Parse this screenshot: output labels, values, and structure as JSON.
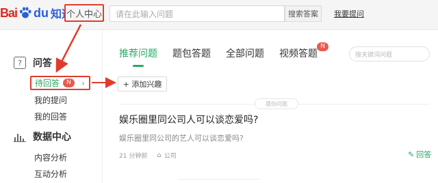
{
  "brand": {
    "bai": "Bai",
    "du": "du",
    "zhidao": "知道"
  },
  "header": {
    "user_center": "个人中心",
    "search_placeholder": "请在此输入问题",
    "search_button": "搜索答案",
    "ask_link": "我要提问"
  },
  "sidebar": {
    "qa_heading": "问答",
    "pending_label": "待回答",
    "pending_badge": "N",
    "my_questions": "我的提问",
    "my_answers": "我的回答",
    "data_heading": "数据中心",
    "content_analysis": "内容分析",
    "interaction_analysis": "互动分析"
  },
  "tabs": [
    {
      "label": "推荐问题"
    },
    {
      "label": "题包答题"
    },
    {
      "label": "全部问题"
    },
    {
      "label": "视频答题",
      "badge": "N"
    }
  ],
  "tab_search_placeholder": "搜关键词问题",
  "interest_button": "+ 添加兴趣",
  "recommend_tag": "猜你问题",
  "question": {
    "title": "娱乐圈里同公司人可以谈恋爱吗?",
    "description": "娱乐圈里同公司的艺人可以谈恋爱吗?",
    "time": "21 分钟前",
    "tag": "公司",
    "answer_label": "回答"
  },
  "colors": {
    "accent": "#2aa865",
    "annotation": "#e03b2c",
    "brand_red": "#e1251b",
    "brand_blue": "#2b5fd9"
  }
}
